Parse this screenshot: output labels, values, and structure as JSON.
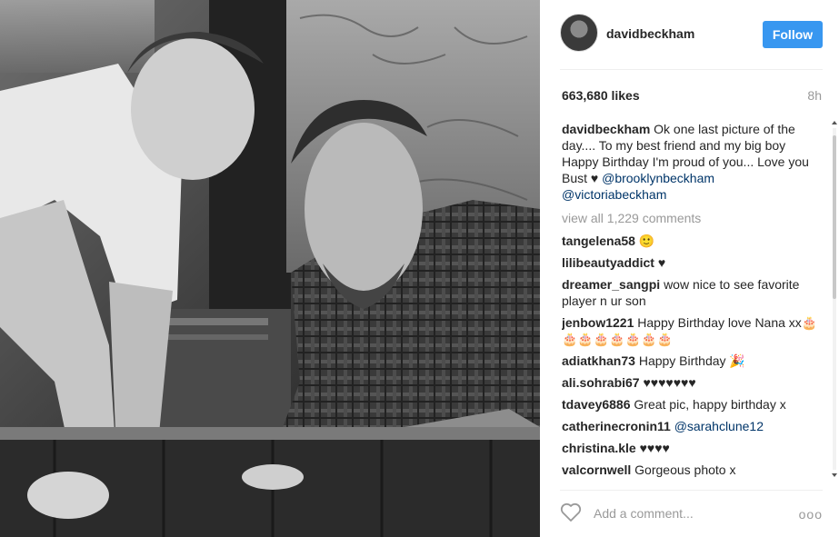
{
  "post": {
    "username": "davidbeckham",
    "follow_label": "Follow",
    "likes": "663,680 likes",
    "time_ago": "8h",
    "caption": {
      "user": "davidbeckham",
      "text": "Ok one last picture of the day.... To my best friend and my big boy Happy Birthday I'm proud of you... Love you Bust ♥",
      "mention1": "@brooklynbeckham",
      "mention2": "@victoriabeckham"
    },
    "view_all": "view all 1,229 comments",
    "comments": [
      {
        "user": "tangelena58",
        "text": "🙂"
      },
      {
        "user": "lilibeautyaddict",
        "text": "♥"
      },
      {
        "user": "dreamer_sangpi",
        "text": "wow nice to see favorite player n ur son"
      },
      {
        "user": "jenbow1221",
        "text": "Happy Birthday love Nana xx🎂🎂🎂🎂🎂🎂🎂🎂"
      },
      {
        "user": "adiatkhan73",
        "text": "Happy Birthday 🎉"
      },
      {
        "user": "ali.sohrabi67",
        "text": "♥♥♥♥♥♥♥"
      },
      {
        "user": "tdavey6886",
        "text": "Great pic, happy birthday x"
      },
      {
        "user": "catherinecronin11",
        "text": "",
        "mention": "@sarahclune12"
      },
      {
        "user": "christina.kle",
        "text": "♥♥♥♥"
      },
      {
        "user": "valcornwell",
        "text": "Gorgeous photo x"
      }
    ],
    "add_comment_placeholder": "Add a comment...",
    "more_label": "ooo"
  },
  "colors": {
    "accent": "#3897f0",
    "mention": "#003569",
    "muted": "#999999"
  },
  "icons": {
    "heart": "heart-outline-icon",
    "more": "more-options-icon"
  }
}
